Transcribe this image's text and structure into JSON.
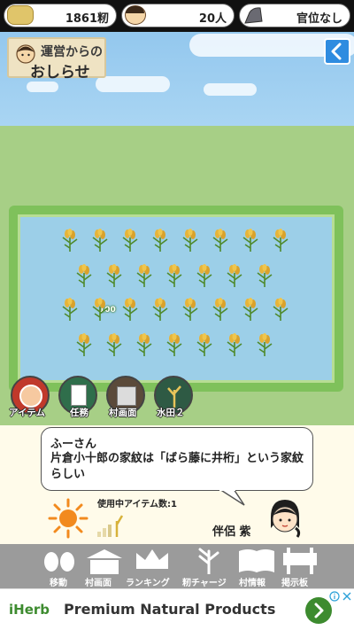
{
  "status": {
    "rice": "1861籾",
    "population": "20人",
    "rank": "官位なし"
  },
  "notice": {
    "line1": "運営からの",
    "line2": "おしらせ"
  },
  "field": {
    "bonus_label": "100"
  },
  "quick_menu": [
    {
      "label": "アイテム"
    },
    {
      "label": "任務"
    },
    {
      "label": "村画面"
    },
    {
      "label": "水田２"
    }
  ],
  "message": {
    "speaker": "ふーさん",
    "text": "片倉小十郎の家紋は「ばら藤に井桁」という家紋らしい"
  },
  "items_in_use": "使用中アイテム数:1",
  "companion": "伴侶 紫",
  "nav": [
    {
      "label": "移動"
    },
    {
      "label": "村画面"
    },
    {
      "label": "ランキング"
    },
    {
      "label": "籾チャージ"
    },
    {
      "label": "村情報"
    },
    {
      "label": "掲示板"
    }
  ],
  "ad": {
    "brand": "iHerb",
    "headline": "Premium Natural Products"
  },
  "colors": {
    "sky": "#8cc3ec",
    "grass": "#a7cf86",
    "water": "#9ccfe8",
    "nav": "#9b9b9b",
    "accent": "#2f8ce0"
  }
}
